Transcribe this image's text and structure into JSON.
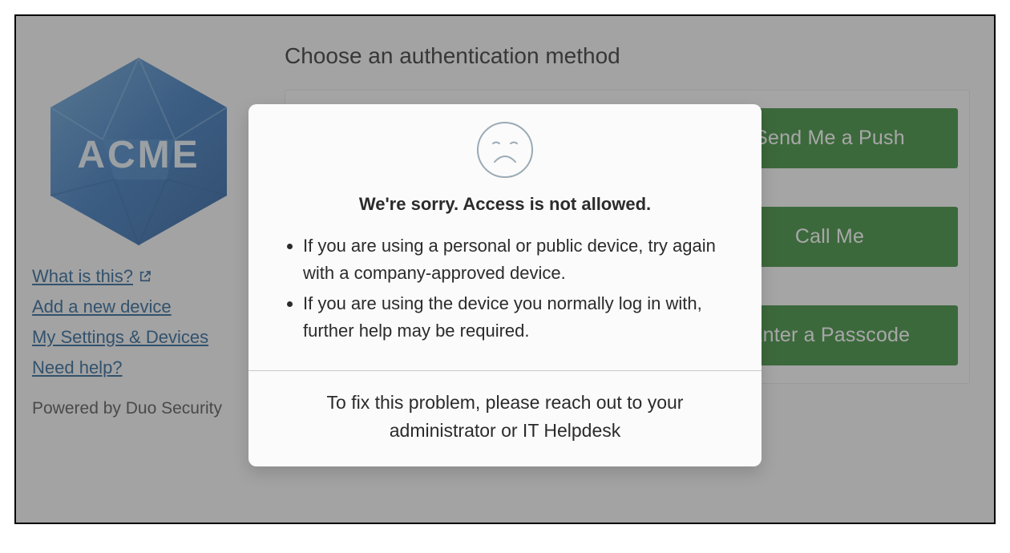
{
  "sidebar": {
    "logo_text": "ACME",
    "links": {
      "what_is_this": "What is this?",
      "add_device": "Add a new device",
      "my_settings": "My Settings & Devices",
      "need_help": "Need help?"
    },
    "powered": "Powered by Duo Security"
  },
  "main": {
    "heading": "Choose an authentication method",
    "buttons": {
      "push": "Send Me a Push",
      "call": "Call Me",
      "passcode": "Enter a Passcode"
    }
  },
  "modal": {
    "title": "We're sorry. Access is not allowed.",
    "bullets": [
      "If you are using a personal or public device, try again with a company-approved device.",
      "If you are using the device you normally log in with, further help may be required."
    ],
    "footer": "To fix this problem, please reach out to your administrator or IT Helpdesk"
  },
  "colors": {
    "button_green": "#3c8f3c",
    "link_blue": "#2a6496"
  }
}
